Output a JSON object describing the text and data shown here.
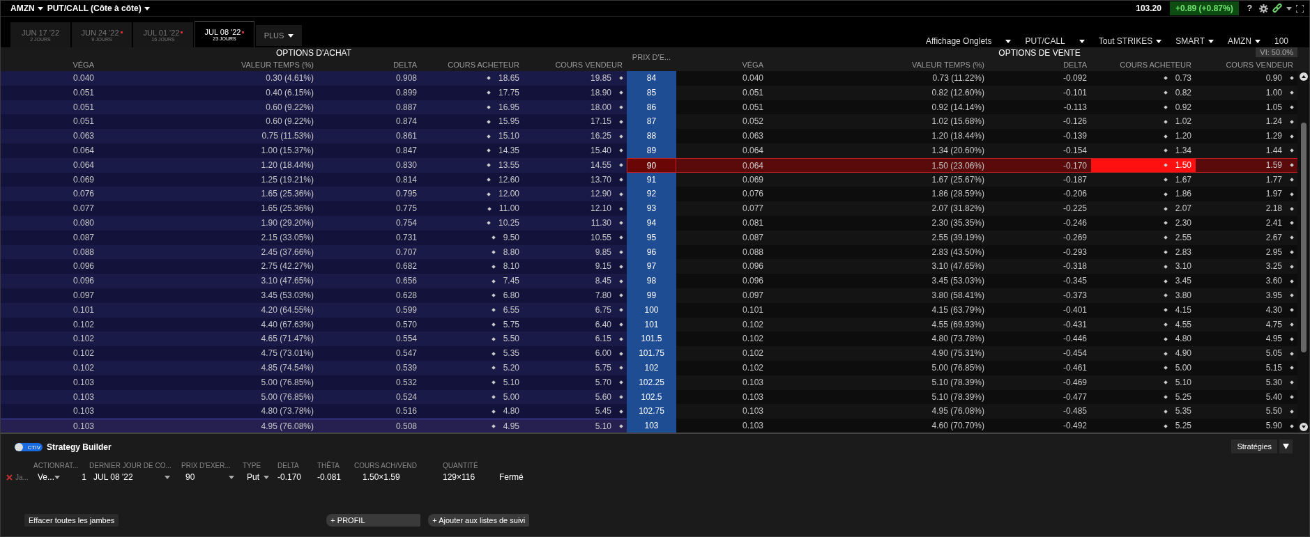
{
  "header": {
    "symbol": "AMZN",
    "view": "PUT/CALL (Côte à côte)",
    "price": "103.20",
    "change": "+0.89 (+0.87%)",
    "help": "?"
  },
  "tabs": [
    {
      "date": "JUN 17 '22",
      "days": "2 JOURS",
      "marked": false,
      "selected": false
    },
    {
      "date": "JUN 24 '22",
      "days": "9 JOURS",
      "marked": true,
      "selected": false
    },
    {
      "date": "JUL 01 '22",
      "days": "16 JOURS",
      "marked": true,
      "selected": false
    },
    {
      "date": "JUL 08 '22",
      "days": "23 JOURS",
      "marked": true,
      "selected": true
    }
  ],
  "more_tab": "PLUS",
  "toolbar": [
    "Affichage Onglets",
    "PUT/CALL",
    "Tout STRIKES",
    "SMART",
    "AMZN"
  ],
  "toolbar_quantity": "100",
  "table": {
    "calls_title": "OPTIONS D'ACHAT",
    "puts_title": "OPTIONS DE VENTE",
    "strike_header": "PRIX D'E...",
    "iv": "VI: 50.0%",
    "call_columns": [
      "VÉGA",
      "VALEUR TEMPS (%)",
      "DELTA",
      "COURS ACHETEUR",
      "COURS VENDEUR"
    ],
    "put_columns": [
      "VÉGA",
      "VALEUR TEMPS (%)",
      "DELTA",
      "COURS ACHETEUR",
      "COURS VENDEUR"
    ],
    "rows": [
      {
        "strike": "84",
        "selected": false,
        "at_money": false,
        "call": [
          "0.040",
          "0.30 (4.61%)",
          "0.908",
          "18.65",
          "19.85"
        ],
        "put": [
          "0.040",
          "0.73 (11.22%)",
          "-0.092",
          "0.73",
          "0.90"
        ]
      },
      {
        "strike": "85",
        "selected": false,
        "at_money": false,
        "call": [
          "0.051",
          "0.40 (6.15%)",
          "0.899",
          "17.75",
          "18.90"
        ],
        "put": [
          "0.051",
          "0.82 (12.60%)",
          "-0.101",
          "0.82",
          "1.00"
        ]
      },
      {
        "strike": "86",
        "selected": false,
        "at_money": false,
        "call": [
          "0.051",
          "0.60 (9.22%)",
          "0.887",
          "16.95",
          "18.00"
        ],
        "put": [
          "0.051",
          "0.92 (14.14%)",
          "-0.113",
          "0.92",
          "1.05"
        ]
      },
      {
        "strike": "87",
        "selected": false,
        "at_money": false,
        "call": [
          "0.051",
          "0.60 (9.22%)",
          "0.874",
          "15.95",
          "17.15"
        ],
        "put": [
          "0.052",
          "1.02 (15.68%)",
          "-0.126",
          "1.02",
          "1.24"
        ]
      },
      {
        "strike": "88",
        "selected": false,
        "at_money": false,
        "call": [
          "0.063",
          "0.75 (11.53%)",
          "0.861",
          "15.10",
          "16.25"
        ],
        "put": [
          "0.063",
          "1.20 (18.44%)",
          "-0.139",
          "1.20",
          "1.29"
        ]
      },
      {
        "strike": "89",
        "selected": false,
        "at_money": false,
        "call": [
          "0.064",
          "1.00 (15.37%)",
          "0.847",
          "14.35",
          "15.40"
        ],
        "put": [
          "0.064",
          "1.34 (20.60%)",
          "-0.154",
          "1.34",
          "1.44"
        ]
      },
      {
        "strike": "90",
        "selected": true,
        "at_money": false,
        "call": [
          "0.064",
          "1.20 (18.44%)",
          "0.830",
          "13.55",
          "14.55"
        ],
        "put": [
          "0.064",
          "1.50 (23.06%)",
          "-0.170",
          "1.50",
          "1.59"
        ]
      },
      {
        "strike": "91",
        "selected": false,
        "at_money": false,
        "call": [
          "0.069",
          "1.25 (19.21%)",
          "0.814",
          "12.60",
          "13.70"
        ],
        "put": [
          "0.069",
          "1.67 (25.67%)",
          "-0.187",
          "1.67",
          "1.77"
        ]
      },
      {
        "strike": "92",
        "selected": false,
        "at_money": false,
        "call": [
          "0.076",
          "1.65 (25.36%)",
          "0.795",
          "12.00",
          "12.90"
        ],
        "put": [
          "0.076",
          "1.86 (28.59%)",
          "-0.206",
          "1.86",
          "1.97"
        ]
      },
      {
        "strike": "93",
        "selected": false,
        "at_money": false,
        "call": [
          "0.077",
          "1.65 (25.36%)",
          "0.775",
          "11.00",
          "12.10"
        ],
        "put": [
          "0.077",
          "2.07 (31.82%)",
          "-0.225",
          "2.07",
          "2.18"
        ]
      },
      {
        "strike": "94",
        "selected": false,
        "at_money": false,
        "call": [
          "0.080",
          "1.90 (29.20%)",
          "0.754",
          "10.25",
          "11.30"
        ],
        "put": [
          "0.081",
          "2.30 (35.35%)",
          "-0.246",
          "2.30",
          "2.41"
        ]
      },
      {
        "strike": "95",
        "selected": false,
        "at_money": false,
        "call": [
          "0.087",
          "2.15 (33.05%)",
          "0.731",
          "9.50",
          "10.55"
        ],
        "put": [
          "0.087",
          "2.55 (39.19%)",
          "-0.269",
          "2.55",
          "2.67"
        ]
      },
      {
        "strike": "96",
        "selected": false,
        "at_money": false,
        "call": [
          "0.088",
          "2.45 (37.66%)",
          "0.707",
          "8.80",
          "9.85"
        ],
        "put": [
          "0.088",
          "2.83 (43.50%)",
          "-0.293",
          "2.83",
          "2.95"
        ]
      },
      {
        "strike": "97",
        "selected": false,
        "at_money": false,
        "call": [
          "0.096",
          "2.75 (42.27%)",
          "0.682",
          "8.10",
          "9.15"
        ],
        "put": [
          "0.096",
          "3.10 (47.65%)",
          "-0.318",
          "3.10",
          "3.25"
        ]
      },
      {
        "strike": "98",
        "selected": false,
        "at_money": false,
        "call": [
          "0.096",
          "3.10 (47.65%)",
          "0.656",
          "7.45",
          "8.45"
        ],
        "put": [
          "0.096",
          "3.45 (53.03%)",
          "-0.345",
          "3.45",
          "3.60"
        ]
      },
      {
        "strike": "99",
        "selected": false,
        "at_money": false,
        "call": [
          "0.097",
          "3.45 (53.03%)",
          "0.628",
          "6.80",
          "7.80"
        ],
        "put": [
          "0.097",
          "3.80 (58.41%)",
          "-0.373",
          "3.80",
          "3.95"
        ]
      },
      {
        "strike": "100",
        "selected": false,
        "at_money": false,
        "call": [
          "0.101",
          "4.20 (64.55%)",
          "0.599",
          "6.55",
          "6.75"
        ],
        "put": [
          "0.101",
          "4.15 (63.79%)",
          "-0.401",
          "4.15",
          "4.30"
        ]
      },
      {
        "strike": "101",
        "selected": false,
        "at_money": false,
        "call": [
          "0.102",
          "4.40 (67.63%)",
          "0.570",
          "5.75",
          "6.40"
        ],
        "put": [
          "0.102",
          "4.55 (69.93%)",
          "-0.431",
          "4.55",
          "4.75"
        ]
      },
      {
        "strike": "101.5",
        "selected": false,
        "at_money": false,
        "call": [
          "0.102",
          "4.65 (71.47%)",
          "0.554",
          "5.50",
          "6.15"
        ],
        "put": [
          "0.102",
          "4.80 (73.78%)",
          "-0.446",
          "4.80",
          "4.95"
        ]
      },
      {
        "strike": "101.75",
        "selected": false,
        "at_money": false,
        "call": [
          "0.102",
          "4.75 (73.01%)",
          "0.547",
          "5.35",
          "6.00"
        ],
        "put": [
          "0.102",
          "4.90 (75.31%)",
          "-0.454",
          "4.90",
          "5.05"
        ]
      },
      {
        "strike": "102",
        "selected": false,
        "at_money": false,
        "call": [
          "0.102",
          "4.85 (74.54%)",
          "0.539",
          "5.20",
          "5.75"
        ],
        "put": [
          "0.102",
          "5.00 (76.85%)",
          "-0.461",
          "5.00",
          "5.15"
        ]
      },
      {
        "strike": "102.25",
        "selected": false,
        "at_money": false,
        "call": [
          "0.103",
          "5.00 (76.85%)",
          "0.532",
          "5.10",
          "5.70"
        ],
        "put": [
          "0.103",
          "5.10 (78.39%)",
          "-0.469",
          "5.10",
          "5.30"
        ]
      },
      {
        "strike": "102.5",
        "selected": false,
        "at_money": false,
        "call": [
          "0.103",
          "5.00 (76.85%)",
          "0.524",
          "5.00",
          "5.60"
        ],
        "put": [
          "0.103",
          "5.10 (78.39%)",
          "-0.477",
          "5.25",
          "5.40"
        ]
      },
      {
        "strike": "102.75",
        "selected": false,
        "at_money": false,
        "call": [
          "0.103",
          "4.80 (73.78%)",
          "0.516",
          "4.80",
          "5.45"
        ],
        "put": [
          "0.103",
          "4.95 (76.08%)",
          "-0.485",
          "5.35",
          "5.50"
        ]
      },
      {
        "strike": "103",
        "selected": false,
        "at_money": true,
        "call": [
          "0.103",
          "4.95 (76.08%)",
          "0.508",
          "4.95",
          "5.10"
        ],
        "put": [
          "0.103",
          "4.60 (70.70%)",
          "-0.492",
          "5.25",
          "5.90"
        ]
      }
    ]
  },
  "strategy": {
    "toggle_label": "CTIV",
    "toggle_on": true,
    "title": "Strategy Builder",
    "strategies_button": "Stratégies",
    "columns": [
      "ACTIONRAT...",
      "DERNIER JOUR DE CO...",
      "PRIX D'EXER...",
      "TYPE",
      "DELTA",
      "THÊTA",
      "COURS ACH/VEND",
      "QUANTITÉ"
    ],
    "legs": [
      {
        "label": "Ja...",
        "action": "Ve...",
        "ratio": "1",
        "expiry": "JUL 08 '22",
        "strike": "90",
        "type": "Put",
        "delta": "-0.170",
        "theta": "-0.081",
        "quote": "1.50×1.59",
        "size": "129×116",
        "status": "Fermé"
      }
    ],
    "buttons": [
      "Effacer toutes les jambes",
      "+ PROFIL",
      "+ Ajouter aux listes de suivi"
    ]
  }
}
